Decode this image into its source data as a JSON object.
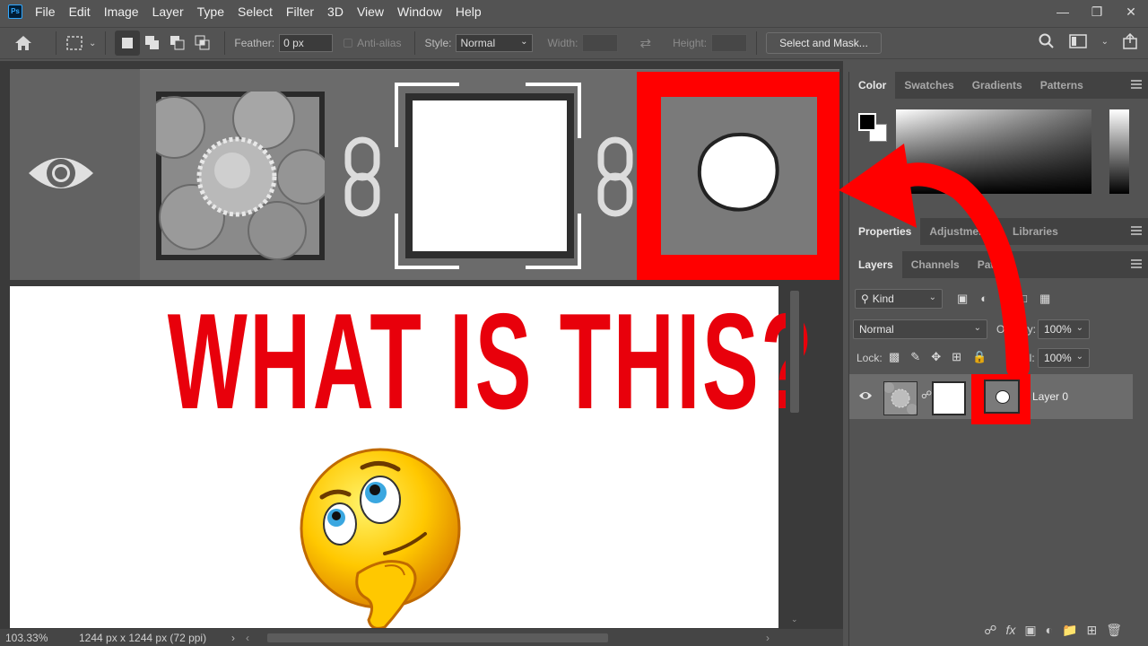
{
  "menu": {
    "app_icon": "Ps",
    "items": [
      "File",
      "Edit",
      "Image",
      "Layer",
      "Type",
      "Select",
      "Filter",
      "3D",
      "View",
      "Window",
      "Help"
    ]
  },
  "options": {
    "feather_label": "Feather:",
    "feather_value": "0 px",
    "antialias_label": "Anti-alias",
    "style_label": "Style:",
    "style_value": "Normal",
    "width_label": "Width:",
    "height_label": "Height:",
    "select_mask_button": "Select and Mask..."
  },
  "canvas": {
    "headline": "WHAT IS THIS?",
    "emoji": "thinking-face"
  },
  "status": {
    "zoom": "103.33%",
    "doc_info": "1244 px x 1244 px (72 ppi)"
  },
  "color_panel": {
    "tabs": [
      "Color",
      "Swatches",
      "Gradients",
      "Patterns"
    ]
  },
  "props_panel": {
    "tabs": [
      "Properties",
      "Adjustments",
      "Libraries"
    ]
  },
  "layers_panel": {
    "tabs": [
      "Layers",
      "Channels",
      "Paths"
    ],
    "kind_label": "Kind",
    "blend_mode": "Normal",
    "opacity_label": "Opacity:",
    "opacity_value": "100%",
    "lock_label": "Lock:",
    "fill_label": "Fill:",
    "fill_value": "100%",
    "layer_name": "Layer 0"
  },
  "colors": {
    "highlight_red": "#ff0000",
    "headline_red": "#e8000b",
    "panel_bg": "#535353"
  }
}
